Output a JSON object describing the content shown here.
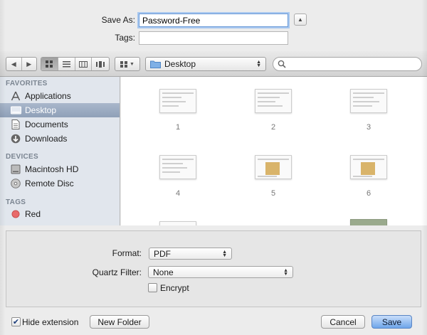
{
  "save_as": {
    "label": "Save As:",
    "value": "Password-Free"
  },
  "tags": {
    "label": "Tags:",
    "value": ""
  },
  "toolbar": {
    "location": "Desktop",
    "search_placeholder": ""
  },
  "sidebar": {
    "favorites_header": "FAVORITES",
    "favorites": [
      {
        "label": "Applications",
        "icon": "applications-icon"
      },
      {
        "label": "Desktop",
        "icon": "desktop-icon",
        "selected": true
      },
      {
        "label": "Documents",
        "icon": "documents-icon"
      },
      {
        "label": "Downloads",
        "icon": "downloads-icon"
      }
    ],
    "devices_header": "DEVICES",
    "devices": [
      {
        "label": "Macintosh HD",
        "icon": "hard-drive-icon"
      },
      {
        "label": "Remote Disc",
        "icon": "disc-icon"
      }
    ],
    "tags_header": "TAGS",
    "tags": [
      {
        "label": "Red",
        "color": "#e86a6a"
      }
    ]
  },
  "files": [
    {
      "label": "1"
    },
    {
      "label": "2"
    },
    {
      "label": "3"
    },
    {
      "label": "4"
    },
    {
      "label": "5"
    },
    {
      "label": "6"
    }
  ],
  "options": {
    "format_label": "Format:",
    "format_value": "PDF",
    "quartz_label": "Quartz Filter:",
    "quartz_value": "None",
    "encrypt_label": "Encrypt"
  },
  "bottom": {
    "hide_extension_label": "Hide extension",
    "new_folder_label": "New Folder",
    "cancel_label": "Cancel",
    "save_label": "Save"
  },
  "colors": {
    "accent": "#6ea5ea",
    "selection": "#8fa0b8",
    "tag_red": "#e86a6a"
  }
}
